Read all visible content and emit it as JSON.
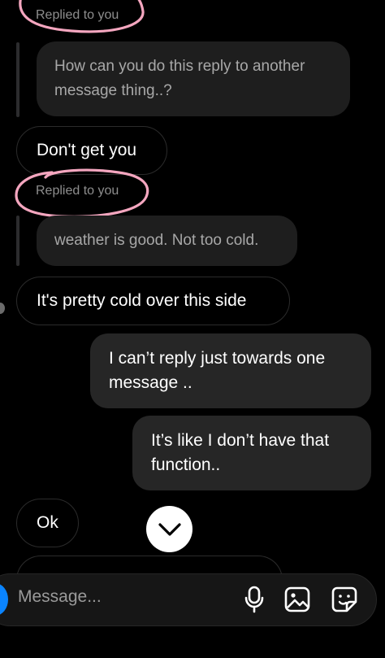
{
  "thread": {
    "reply_label_1": "Replied to you",
    "quoted_1": "How can you do this reply to another message thing..?",
    "msg_1": "Don't get you",
    "reply_label_2": "Replied to you",
    "quoted_2": "weather is good. Not too cold.",
    "msg_2": "It's pretty cold over this side",
    "out_1": "I can’t reply just towards one message ..",
    "out_2": "It’s like I don’t have that function..",
    "msg_3": "Ok"
  },
  "composer": {
    "placeholder": "Message...",
    "icons": [
      "microphone-icon",
      "gallery-icon",
      "sticker-icon"
    ]
  },
  "colors": {
    "background": "#000000",
    "outgoing_bubble": "#262626",
    "quoted_bubble": "#1e1e1e",
    "annotation_circle": "#f4a6bf",
    "accent_blue": "#0a84ff"
  }
}
